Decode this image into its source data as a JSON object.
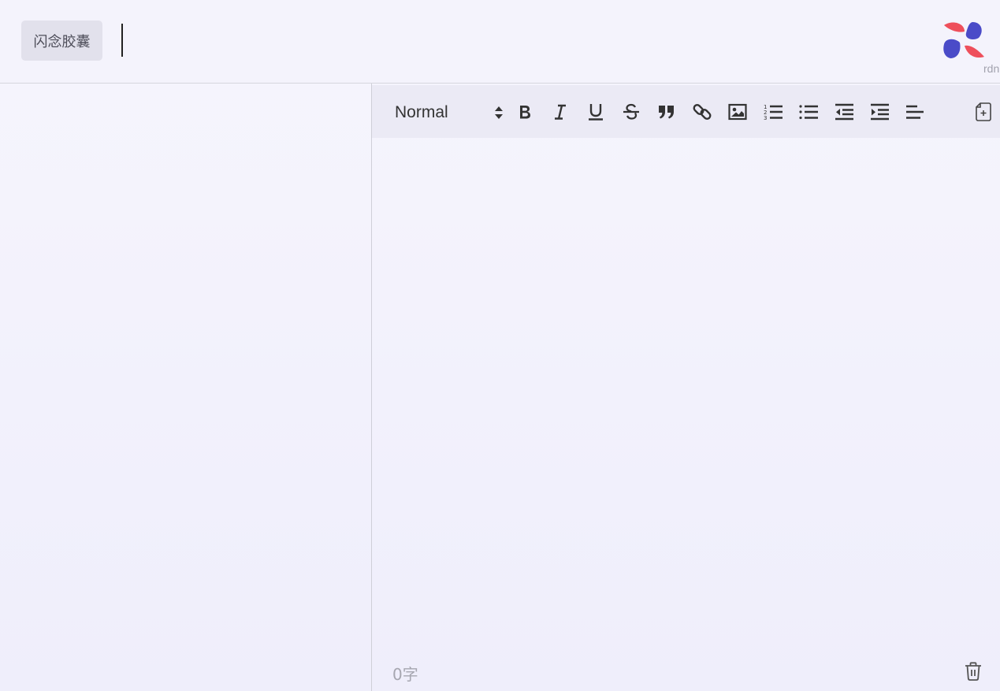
{
  "header": {
    "tag_label": "闪念胶囊",
    "logo_caption": "rdn"
  },
  "editor": {
    "format_select": {
      "value": "Normal"
    },
    "toolbar_icons": [
      "bold-icon",
      "italic-icon",
      "underline-icon",
      "strikethrough-icon",
      "blockquote-icon",
      "link-icon",
      "image-icon",
      "ordered-list-icon",
      "bullet-list-icon",
      "outdent-icon",
      "indent-icon",
      "align-left-icon",
      "new-note-icon"
    ],
    "content": "",
    "word_count": "0字"
  },
  "colors": {
    "logo_red": "#ee4f5b",
    "logo_blue": "#4a4bc8",
    "background": "#f4f3fc",
    "toolbar": "#ebeaf5"
  }
}
